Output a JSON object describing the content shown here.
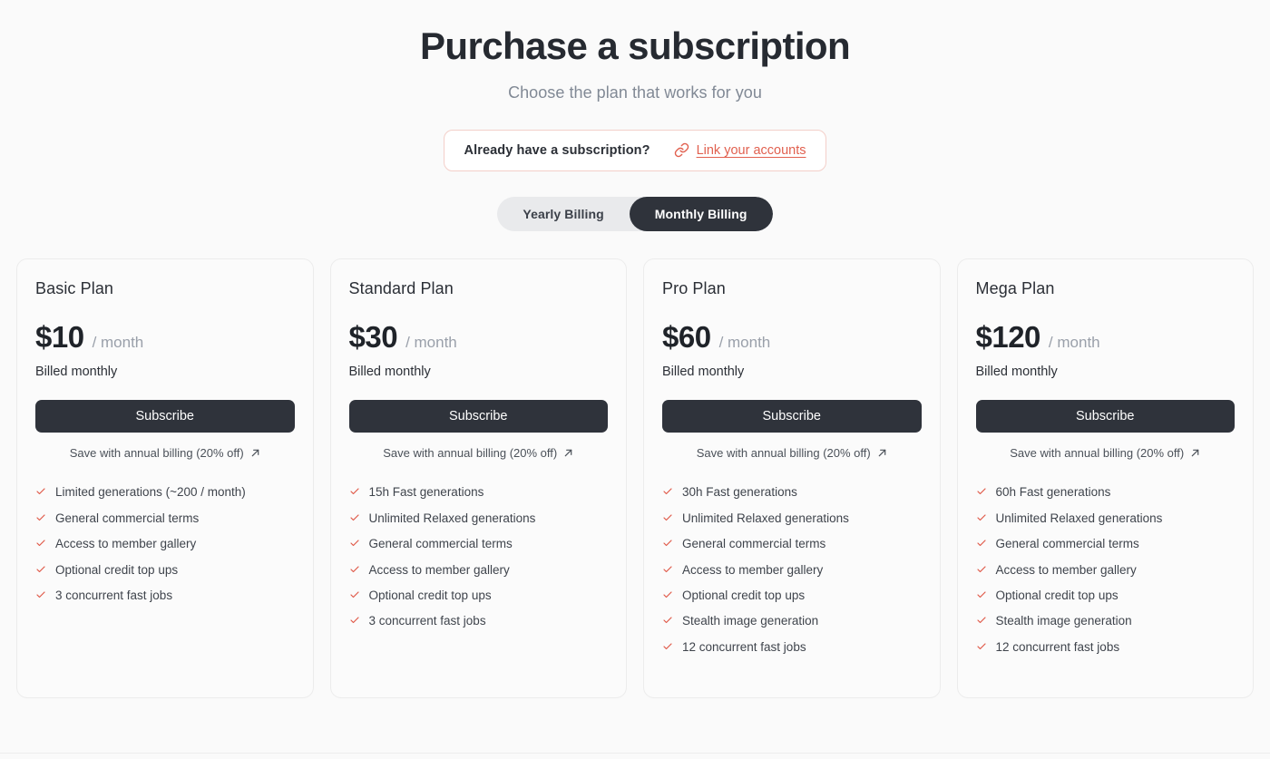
{
  "header": {
    "title": "Purchase a subscription",
    "subtitle": "Choose the plan that works for you"
  },
  "link_banner": {
    "question": "Already have a subscription?",
    "link_label": "Link your accounts",
    "link_icon": "link-chain-icon",
    "border_color": "#f3cfc9",
    "accent_color": "#e1604f"
  },
  "billing_toggle": {
    "options": [
      {
        "label": "Yearly Billing",
        "active": false
      },
      {
        "label": "Monthly Billing",
        "active": true
      }
    ],
    "active_bg": "#2f333b",
    "track_bg": "#e9eaec"
  },
  "plans": [
    {
      "name": "Basic Plan",
      "price": "$10",
      "period": "/ month",
      "billed": "Billed monthly",
      "cta": "Subscribe",
      "annual_link": "Save with annual billing (20% off)",
      "annual_icon": "arrow-up-right-icon",
      "features": [
        "Limited generations (~200 / month)",
        "General commercial terms",
        "Access to member gallery",
        "Optional credit top ups",
        "3 concurrent fast jobs"
      ]
    },
    {
      "name": "Standard Plan",
      "price": "$30",
      "period": "/ month",
      "billed": "Billed monthly",
      "cta": "Subscribe",
      "annual_link": "Save with annual billing (20% off)",
      "annual_icon": "arrow-up-right-icon",
      "features": [
        "15h Fast generations",
        "Unlimited Relaxed generations",
        "General commercial terms",
        "Access to member gallery",
        "Optional credit top ups",
        "3 concurrent fast jobs"
      ]
    },
    {
      "name": "Pro Plan",
      "price": "$60",
      "period": "/ month",
      "billed": "Billed monthly",
      "cta": "Subscribe",
      "annual_link": "Save with annual billing (20% off)",
      "annual_icon": "arrow-up-right-icon",
      "features": [
        "30h Fast generations",
        "Unlimited Relaxed generations",
        "General commercial terms",
        "Access to member gallery",
        "Optional credit top ups",
        "Stealth image generation",
        "12 concurrent fast jobs"
      ]
    },
    {
      "name": "Mega Plan",
      "price": "$120",
      "period": "/ month",
      "billed": "Billed monthly",
      "cta": "Subscribe",
      "annual_link": "Save with annual billing (20% off)",
      "annual_icon": "arrow-up-right-icon",
      "features": [
        "60h Fast generations",
        "Unlimited Relaxed generations",
        "General commercial terms",
        "Access to member gallery",
        "Optional credit top ups",
        "Stealth image generation",
        "12 concurrent fast jobs"
      ]
    }
  ],
  "colors": {
    "page_bg": "#fafafa",
    "card_bg": "#fbfbfb",
    "card_border": "#ececec",
    "button_dark": "#2f333b",
    "check_red": "#e05a49",
    "muted_text": "#818995"
  }
}
